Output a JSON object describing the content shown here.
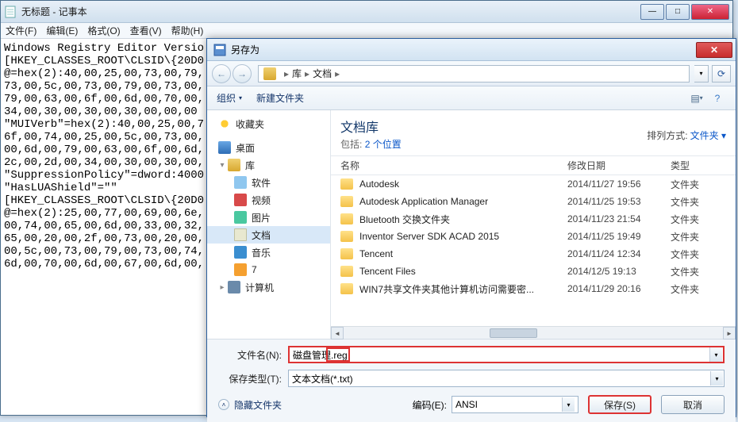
{
  "notepad": {
    "title": "无标题 - 记事本",
    "menu": {
      "file": "文件(F)",
      "edit": "编辑(E)",
      "format": "格式(O)",
      "view": "查看(V)",
      "help": "帮助(H)"
    },
    "body": "Windows Registry Editor Versio\n[HKEY_CLASSES_ROOT\\CLSID\\{20D0\n@=hex(2):40,00,25,00,73,00,79,\n73,00,5c,00,73,00,79,00,73,00,\n79,00,63,00,6f,00,6d,00,70,00,\n34,00,30,00,30,00,30,00,00,00\n\"MUIVerb\"=hex(2):40,00,25,00,7\n6f,00,74,00,25,00,5c,00,73,00,\n00,6d,00,79,00,63,00,6f,00,6d,\n2c,00,2d,00,34,00,30,00,30,00,\n\"SuppressionPolicy\"=dword:4000\n\"HasLUAShield\"=\"\"\n[HKEY_CLASSES_ROOT\\CLSID\\{20D0\n@=hex(2):25,00,77,00,69,00,6e,\n00,74,00,65,00,6d,00,33,00,32,\n65,00,20,00,2f,00,73,00,20,00,\n00,5c,00,73,00,79,00,73,00,74,\n6d,00,70,00,6d,00,67,00,6d,00,"
  },
  "dialog": {
    "title": "另存为",
    "nav": {
      "back": "←",
      "fwd": "→",
      "lib_icon": "库",
      "path1": "库",
      "path2": "文档",
      "refresh": "⟳"
    },
    "toolbar": {
      "organize": "组织",
      "newfolder": "新建文件夹"
    },
    "tree": {
      "fav": "收藏夹",
      "desktop": "桌面",
      "lib": "库",
      "soft": "软件",
      "video": "视频",
      "pic": "图片",
      "doc": "文档",
      "music": "音乐",
      "seven": "7",
      "computer": "计算机"
    },
    "libhead": {
      "title": "文档库",
      "includes_label": "包括:",
      "includes_link": "2 个位置",
      "sort_label": "排列方式:",
      "sort_value": "文件夹"
    },
    "cols": {
      "name": "名称",
      "date": "修改日期",
      "type": "类型"
    },
    "rows": [
      {
        "n": "Autodesk",
        "d": "2014/11/27 19:56",
        "t": "文件夹"
      },
      {
        "n": "Autodesk Application Manager",
        "d": "2014/11/25 19:53",
        "t": "文件夹"
      },
      {
        "n": "Bluetooth 交换文件夹",
        "d": "2014/11/23 21:54",
        "t": "文件夹"
      },
      {
        "n": "Inventor Server SDK ACAD 2015",
        "d": "2014/11/25 19:49",
        "t": "文件夹"
      },
      {
        "n": "Tencent",
        "d": "2014/11/24 12:34",
        "t": "文件夹"
      },
      {
        "n": "Tencent Files",
        "d": "2014/12/5 19:13",
        "t": "文件夹"
      },
      {
        "n": "WIN7共享文件夹其他计算机访问需要密...",
        "d": "2014/11/29 20:16",
        "t": "文件夹"
      }
    ],
    "filename_label": "文件名(N):",
    "filename_value": "磁盘管理.reg",
    "filetype_label": "保存类型(T):",
    "filetype_value": "文本文档(*.txt)",
    "hidefolders": "隐藏文件夹",
    "encoding_label": "编码(E):",
    "encoding_value": "ANSI",
    "save_btn": "保存(S)",
    "cancel_btn": "取消"
  }
}
